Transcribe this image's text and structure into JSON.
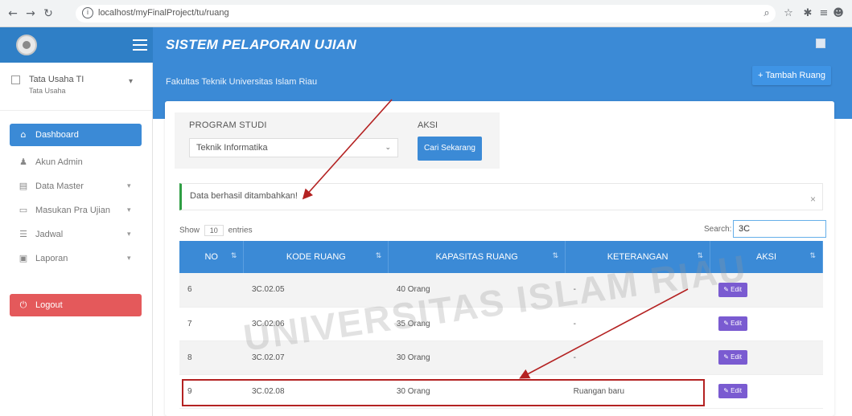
{
  "browser": {
    "url": "localhost/myFinalProject/tu/ruang"
  },
  "app": {
    "title": "SISTEM PELAPORAN UJIAN"
  },
  "user": {
    "name": "Tata Usaha TI",
    "role": "Tata Usaha"
  },
  "sidebar": {
    "items": [
      {
        "label": "Dashboard",
        "icon": "home-icon",
        "active": true
      },
      {
        "label": "Akun Admin",
        "icon": "user-icon"
      },
      {
        "label": "Data Master",
        "icon": "database-icon",
        "caret": "▾"
      },
      {
        "label": "Masukan Pra Ujian",
        "icon": "keyboard-icon",
        "caret": "▾"
      },
      {
        "label": "Jadwal",
        "icon": "list-icon",
        "caret": "▾"
      },
      {
        "label": "Laporan",
        "icon": "report-icon",
        "caret": "▾"
      },
      {
        "label": "Logout",
        "icon": "power-icon"
      }
    ]
  },
  "content": {
    "breadcrumb": "Fakultas Teknik Universitas Islam Riau",
    "add_button": "+ Tambah Ruang",
    "filter": {
      "program_label": "PROGRAM STUDI",
      "program_value": "Teknik Informatika",
      "aksi_label": "AKSI",
      "search_button": "Cari Sekarang"
    },
    "alert": "Data berhasil ditambahkan!",
    "table_controls": {
      "show": "Show",
      "entries_value": "10",
      "entries": "entries",
      "search_label": "Search:",
      "search_value": "3C"
    },
    "table": {
      "headers": [
        "NO",
        "KODE RUANG",
        "KAPASITAS RUANG",
        "KETERANGAN",
        "AKSI"
      ],
      "rows": [
        {
          "no": "6",
          "kode": "3C.02.05",
          "kapasitas": "40 Orang",
          "keterangan": "-",
          "aksi": "Edit"
        },
        {
          "no": "7",
          "kode": "3C.02.06",
          "kapasitas": "35 Orang",
          "keterangan": "-",
          "aksi": "Edit"
        },
        {
          "no": "8",
          "kode": "3C.02.07",
          "kapasitas": "30 Orang",
          "keterangan": "-",
          "aksi": "Edit"
        },
        {
          "no": "9",
          "kode": "3C.02.08",
          "kapasitas": "30 Orang",
          "keterangan": "Ruangan baru",
          "aksi": "Edit"
        }
      ]
    }
  },
  "watermark": "UNIVERSITAS ISLAM RIAU",
  "colors": {
    "primary": "#3b8ad6",
    "logout": "#e4595b",
    "edit": "#7a5bd1",
    "annotation": "#b42222",
    "alert_border": "#2f9e44"
  }
}
